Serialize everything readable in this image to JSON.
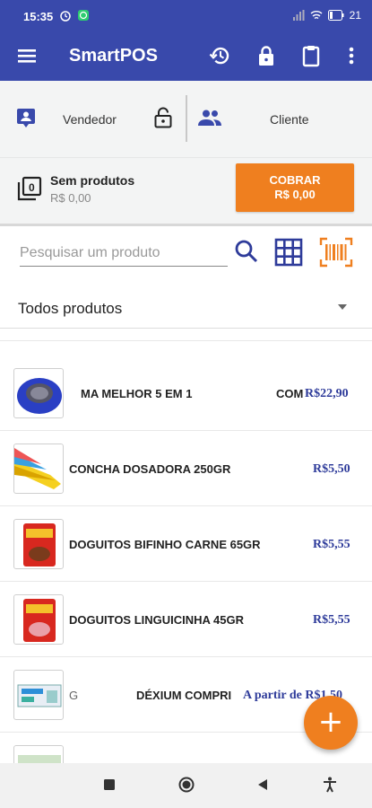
{
  "status_bar": {
    "time": "15:35",
    "battery": "21"
  },
  "app_bar": {
    "title": "SmartPOS"
  },
  "seller": {
    "label": "Vendedor"
  },
  "client": {
    "label": "Cliente"
  },
  "cart": {
    "count": "0",
    "title": "Sem produtos",
    "total": "R$ 0,00"
  },
  "charge_button": {
    "line1": "COBRAR",
    "line2": "R$ 0,00"
  },
  "search": {
    "placeholder": "Pesquisar um produto"
  },
  "filter": {
    "selected": "Todos produtos"
  },
  "products": [
    {
      "name": "MA MELHOR 5 EM 1",
      "name2": "COM",
      "price": "R$22,90"
    },
    {
      "name": "CONCHA DOSADORA 250GR",
      "price": "R$5,50"
    },
    {
      "name": "DOGUITOS BIFINHO CARNE 65GR",
      "price": "R$5,55"
    },
    {
      "name": "DOGUITOS LINGUICINHA 45GR",
      "price": "R$5,55"
    },
    {
      "name": "G",
      "name2": "DÉXIUM COMPRI",
      "price": "A partir de R$1,50"
    }
  ],
  "fab": {
    "label": "+"
  },
  "colors": {
    "primary": "#3949ab",
    "accent": "#ef7f1f",
    "price": "#2e3b9a"
  },
  "icons": {
    "menu": "menu-icon",
    "history": "history-icon",
    "lock": "lock-icon",
    "clipboard": "clipboard-icon",
    "more": "more-vert-icon",
    "search": "search-icon",
    "grid": "grid-icon",
    "barcode": "barcode-icon"
  }
}
